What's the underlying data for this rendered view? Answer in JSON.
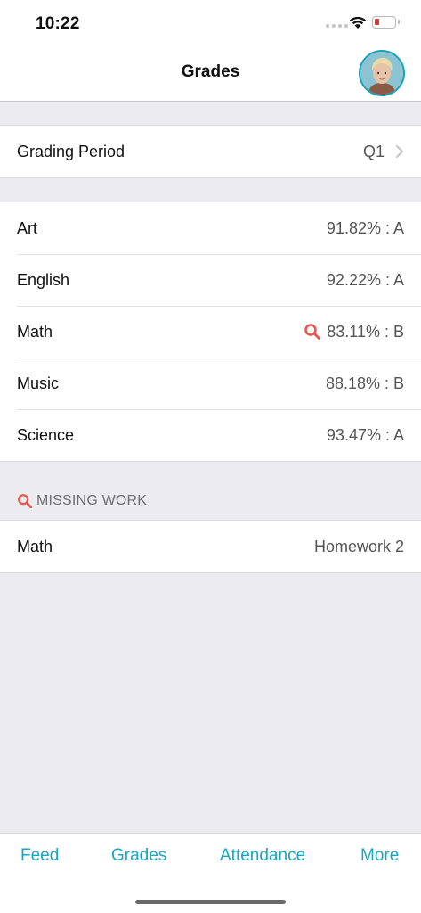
{
  "status_bar": {
    "time": "10:22"
  },
  "nav": {
    "title": "Grades"
  },
  "grading_period": {
    "label": "Grading Period",
    "value": "Q1"
  },
  "grades": [
    {
      "subject": "Art",
      "grade": "91.82% :  A",
      "flag": false
    },
    {
      "subject": "English",
      "grade": "92.22% :  A",
      "flag": false
    },
    {
      "subject": "Math",
      "grade": "83.11% :  B",
      "flag": true
    },
    {
      "subject": "Music",
      "grade": "88.18% :  B",
      "flag": false
    },
    {
      "subject": "Science",
      "grade": "93.47% :  A",
      "flag": false
    }
  ],
  "missing_work": {
    "header": "MISSING WORK",
    "items": [
      {
        "subject": "Math",
        "assignment": "Homework 2"
      }
    ]
  },
  "tabs": [
    {
      "label": "Feed"
    },
    {
      "label": "Grades"
    },
    {
      "label": "Attendance"
    },
    {
      "label": "More"
    }
  ],
  "colors": {
    "accent": "#17a7c2",
    "alert": "#e8564f",
    "background": "#ebebf0"
  }
}
